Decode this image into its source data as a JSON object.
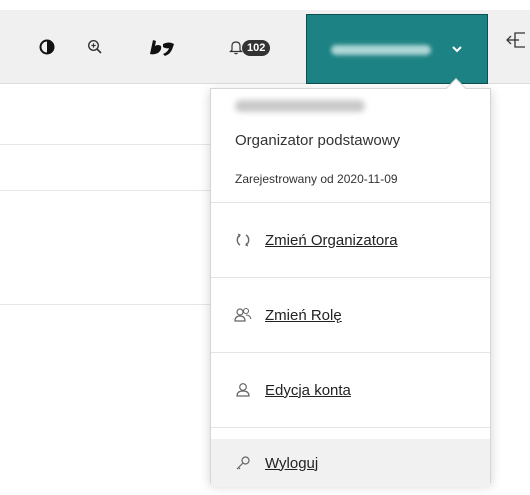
{
  "header": {
    "notifications_count": "102"
  },
  "icons": {
    "contrast": "contrast-icon",
    "zoom": "zoom-in-icon",
    "sign_language": "sign-language-icon",
    "bell": "bell-icon",
    "chevron": "chevron-down-icon",
    "exit": "sign-out-icon"
  },
  "colors": {
    "accent": "#1d8283",
    "topbar": "#f0f0f0"
  },
  "dropdown": {
    "role": "Organizator podstawowy",
    "registered": "Zarejestrowany od 2020-11-09",
    "items": [
      {
        "label": "Zmień Organizatora",
        "icon": "switch-icon"
      },
      {
        "label": "Zmień Rolę",
        "icon": "users-icon"
      },
      {
        "label": "Edycja konta",
        "icon": "user-icon"
      },
      {
        "label": "Wyloguj",
        "icon": "key-icon"
      }
    ]
  }
}
